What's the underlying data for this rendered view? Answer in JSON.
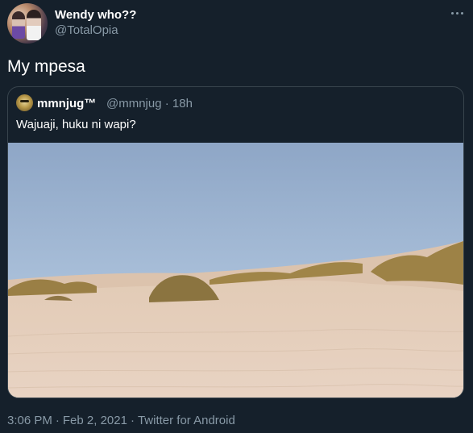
{
  "tweet": {
    "author": {
      "display_name": "Wendy who??",
      "handle": "@TotalOpia"
    },
    "text": "My mpesa",
    "menu_icon": "more-icon",
    "quoted": {
      "author": {
        "display_name": "mmnjug™",
        "handle": "@mmnjug",
        "time": "18h"
      },
      "handle_time": "@mmnjug · 18h",
      "text": "Wajuaji, huku ni wapi?",
      "image_description": "sand dunes with grass under blue sky"
    },
    "footer": {
      "time": "3:06 PM",
      "date": "Feb 2, 2021",
      "source": "Twitter for Android"
    }
  },
  "colors": {
    "background": "#15202b",
    "border": "#38444d",
    "secondary_text": "#8899a6",
    "primary_text": "#ffffff"
  }
}
